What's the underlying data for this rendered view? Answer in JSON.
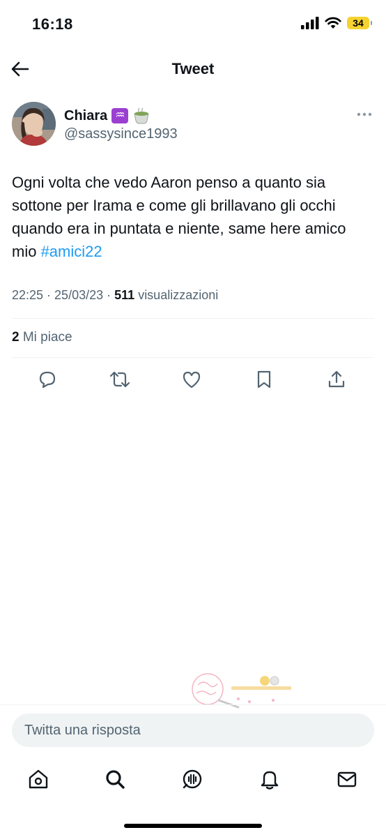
{
  "status_bar": {
    "time": "16:18",
    "battery": "34",
    "icons": [
      "cellular-signal-icon",
      "wifi-icon",
      "battery-icon"
    ]
  },
  "header": {
    "title": "Tweet",
    "back_icon": "arrow-left-icon"
  },
  "tweet": {
    "author_name": "Chiara",
    "author_emojis": [
      "♒",
      "🍵"
    ],
    "author_handle": "@sassysince1993",
    "text_before_hashtag": "Ogni volta che vedo Aaron penso a quanto sia sottone per Irama e come gli brillavano gli occhi quando era in puntata e niente, same here amico mio ",
    "hashtag": "#amici22",
    "time": "22:25",
    "date": "25/03/23",
    "views_count": "511",
    "views_label": "visualizzazioni",
    "likes_count": "2",
    "likes_label": "Mi piace"
  },
  "actions": [
    {
      "name": "reply",
      "icon": "comment-icon"
    },
    {
      "name": "retweet",
      "icon": "retweet-icon"
    },
    {
      "name": "like",
      "icon": "heart-icon"
    },
    {
      "name": "bookmark",
      "icon": "bookmark-icon"
    },
    {
      "name": "share",
      "icon": "share-icon"
    }
  ],
  "reply": {
    "placeholder": "Twitta una risposta"
  },
  "tab_bar": [
    {
      "name": "home",
      "icon": "home-icon"
    },
    {
      "name": "search",
      "icon": "search-icon"
    },
    {
      "name": "spaces",
      "icon": "spaces-icon"
    },
    {
      "name": "notifications",
      "icon": "bell-icon"
    },
    {
      "name": "messages",
      "icon": "mail-icon"
    }
  ],
  "colors": {
    "accent": "#1d9bf0",
    "text_primary": "#0f1419",
    "text_secondary": "#536471",
    "divider": "#eff3f4",
    "battery": "#f5d230"
  }
}
